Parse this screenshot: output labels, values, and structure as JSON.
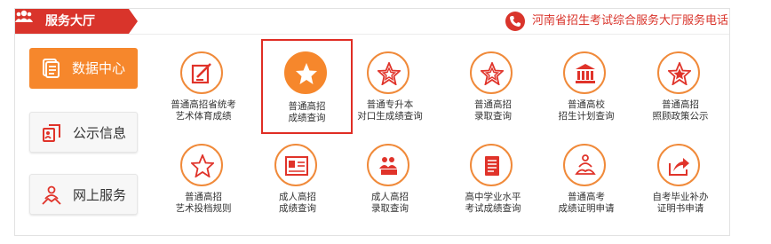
{
  "header": {
    "title": "服务大厅",
    "hotline": "河南省招生考试综合服务大厅服务电话",
    "tab_color": "#d9342b"
  },
  "nav": [
    {
      "label": "数据中心",
      "icon": "data-center-icon",
      "active": true
    },
    {
      "label": "公示信息",
      "icon": "announcement-icon",
      "active": false
    },
    {
      "label": "网上服务",
      "icon": "online-service-icon",
      "active": false
    }
  ],
  "services_row1": [
    {
      "line1": "普通高招省统考",
      "line2": "艺术体育成绩",
      "icon": "edit-icon"
    },
    {
      "line1": "普通高招",
      "line2": "成绩查询",
      "icon": "star-icon",
      "selected": true
    },
    {
      "line1": "普通专升本",
      "line2": "对口生成绩查询",
      "icon": "star-icon"
    },
    {
      "line1": "普通高招",
      "line2": "录取查询",
      "icon": "star-icon"
    },
    {
      "line1": "普通高校",
      "line2": "招生计划查询",
      "icon": "university-icon"
    },
    {
      "line1": "普通高招",
      "line2": "照顾政策公示",
      "icon": "star-icon"
    }
  ],
  "services_row2": [
    {
      "line1": "普通高招",
      "line2": "艺术投档规则",
      "icon": "star-outline-icon"
    },
    {
      "line1": "成人高招",
      "line2": "成绩查询",
      "icon": "id-card-icon"
    },
    {
      "line1": "成人高招",
      "line2": "录取查询",
      "icon": "group-icon"
    },
    {
      "line1": "高中学业水平",
      "line2": "考试成绩查询",
      "icon": "document-icon"
    },
    {
      "line1": "普通高考",
      "line2": "成绩证明申请",
      "icon": "meditation-icon"
    },
    {
      "line1": "自考毕业补办",
      "line2": "证明书申请",
      "icon": "share-icon"
    }
  ],
  "colors": {
    "accent": "#f6872c",
    "highlight_border": "#e02d24",
    "text": "#333333"
  }
}
